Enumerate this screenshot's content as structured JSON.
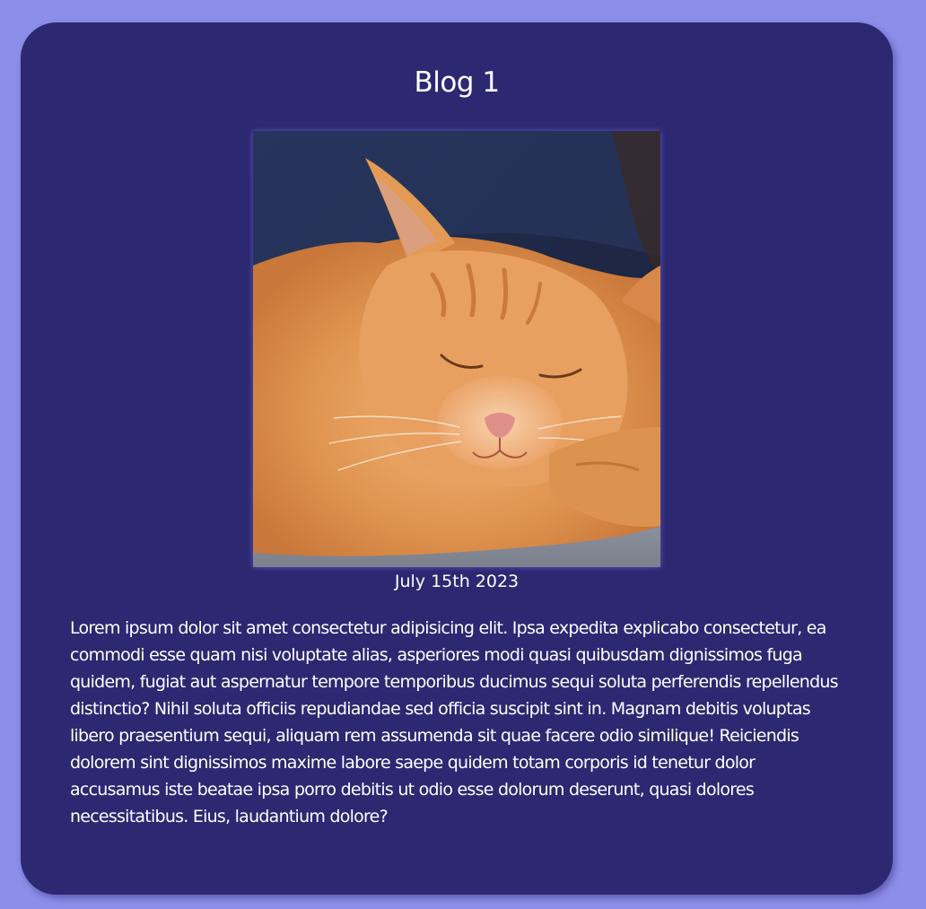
{
  "page": {
    "background_color": "#8d8eea",
    "card_color": "#2c2872"
  },
  "blog": {
    "title": "Blog 1",
    "image_subject": "sleeping-orange-tabby-cat",
    "date": "July 15th 2023",
    "body": "Lorem ipsum dolor sit amet consectetur adipisicing elit. Ipsa expedita explicabo consectetur, ea commodi esse quam nisi voluptate alias, asperiores modi quasi quibusdam dignissimos fuga quidem, fugiat aut aspernatur tempore temporibus ducimus sequi soluta perferendis repellendus distinctio? Nihil soluta officiis repudiandae sed officia suscipit sint in. Magnam debitis voluptas libero praesentium sequi, aliquam rem assumenda sit quae facere odio similique! Reiciendis dolorem sint dignissimos maxime labore saepe quidem totam corporis id tenetur dolor accusamus iste beatae ipsa porro debitis ut odio esse dolorum deserunt, quasi dolores necessitatibus. Eius, laudantium dolore?"
  }
}
